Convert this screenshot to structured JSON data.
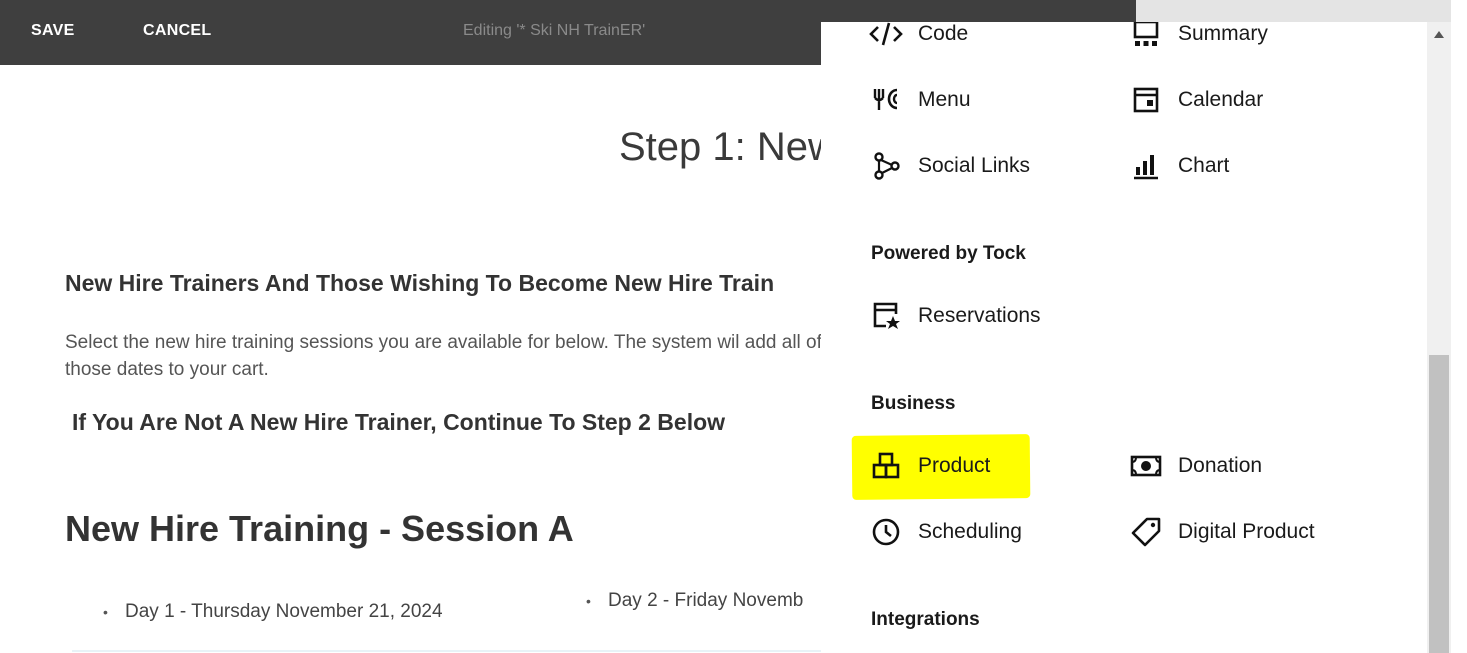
{
  "topbar": {
    "save_label": "SAVE",
    "cancel_label": "CANCEL",
    "editing_title": "Editing '* Ski NH TrainER'"
  },
  "page": {
    "step_title": "Step 1: New",
    "trainers_heading": "New Hire Trainers And Those Wishing To Become New Hire Train",
    "instructions": "Select the new hire training sessions you are available for below.  The system wil add all of those dates to your cart.",
    "not_trainer_heading": "If You Are Not A New Hire Trainer, Continue To Step 2 Below",
    "session_heading": "New Hire Training - Session A",
    "day1": "Day 1 - Thursday November 21, 2024",
    "day2": "Day 2 - Friday Novemb",
    "bullet": "•"
  },
  "panel": {
    "blocks_top": [
      {
        "label": "Code",
        "icon": "code-icon"
      },
      {
        "label": "Summary",
        "icon": "summary-icon"
      },
      {
        "label": "Menu",
        "icon": "menu-fork-icon"
      },
      {
        "label": "Calendar",
        "icon": "calendar-icon"
      },
      {
        "label": "Social Links",
        "icon": "social-links-icon"
      },
      {
        "label": "Chart",
        "icon": "chart-icon"
      }
    ],
    "powered_by_tock": {
      "heading": "Powered by Tock",
      "items": [
        {
          "label": "Reservations",
          "icon": "reservations-icon"
        }
      ]
    },
    "business": {
      "heading": "Business",
      "items": [
        {
          "label": "Product",
          "icon": "product-icon"
        },
        {
          "label": "Donation",
          "icon": "donation-icon"
        },
        {
          "label": "Scheduling",
          "icon": "clock-icon"
        },
        {
          "label": "Digital Product",
          "icon": "tag-icon"
        }
      ]
    },
    "integrations": {
      "heading": "Integrations"
    },
    "highlight_color": "#ffff00"
  },
  "colors": {
    "topbar_bg": "#3f3f3f",
    "scroll_thumb": "#c1c1c1"
  }
}
